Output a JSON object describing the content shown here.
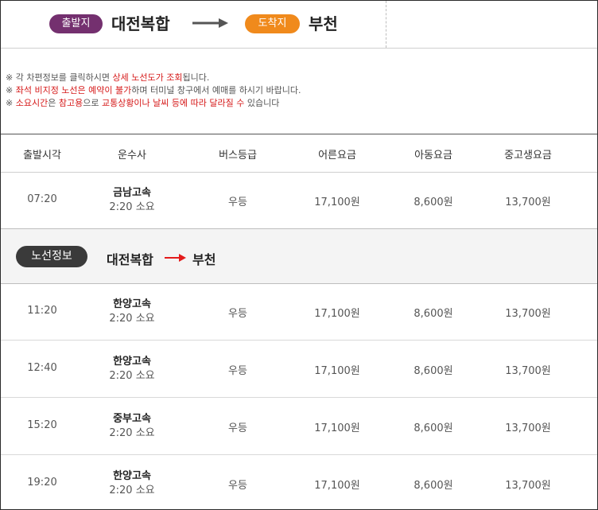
{
  "header": {
    "departure_label": "출발지",
    "departure_city": "대전복합",
    "arrival_label": "도착지",
    "arrival_city": "부천",
    "colors": {
      "departure": "#74306f",
      "arrival": "#f08a1c"
    }
  },
  "notes": {
    "line1": {
      "a": "※ 각 차편정보를 클릭하시면 ",
      "b": "상세 노선도가 조회",
      "c": "됩니다."
    },
    "line2": {
      "a": "※ ",
      "b": "좌석 비지정 노선은 예약이 불가",
      "c": "하며 터미널 창구에서 예매를 하시기 바랍니다."
    },
    "line3": {
      "a": "※ ",
      "b": "소요시간",
      "c": "은 ",
      "d": "참고용",
      "e": "으로 ",
      "f": "교통상황이나 날씨 등에 따라 달라질 수",
      "g": " 있습니다"
    }
  },
  "table": {
    "columns": [
      "출발시각",
      "운수사",
      "버스등급",
      "어른요금",
      "아동요금",
      "중고생요금"
    ],
    "rows_before_route": [
      {
        "time": "07:20",
        "company": "금남고속",
        "duration": "2:20 소요",
        "grade": "우등",
        "adult": "17,100원",
        "child": "8,600원",
        "student": "13,700원"
      }
    ],
    "route_info": {
      "label": "노선정보",
      "from": "대전복합",
      "to": "부천"
    },
    "rows_after_route": [
      {
        "time": "11:20",
        "company": "한양고속",
        "duration": "2:20 소요",
        "grade": "우등",
        "adult": "17,100원",
        "child": "8,600원",
        "student": "13,700원"
      },
      {
        "time": "12:40",
        "company": "한양고속",
        "duration": "2:20 소요",
        "grade": "우등",
        "adult": "17,100원",
        "child": "8,600원",
        "student": "13,700원"
      },
      {
        "time": "15:20",
        "company": "중부고속",
        "duration": "2:20 소요",
        "grade": "우등",
        "adult": "17,100원",
        "child": "8,600원",
        "student": "13,700원"
      },
      {
        "time": "19:20",
        "company": "한양고속",
        "duration": "2:20 소요",
        "grade": "우등",
        "adult": "17,100원",
        "child": "8,600원",
        "student": "13,700원"
      }
    ]
  }
}
